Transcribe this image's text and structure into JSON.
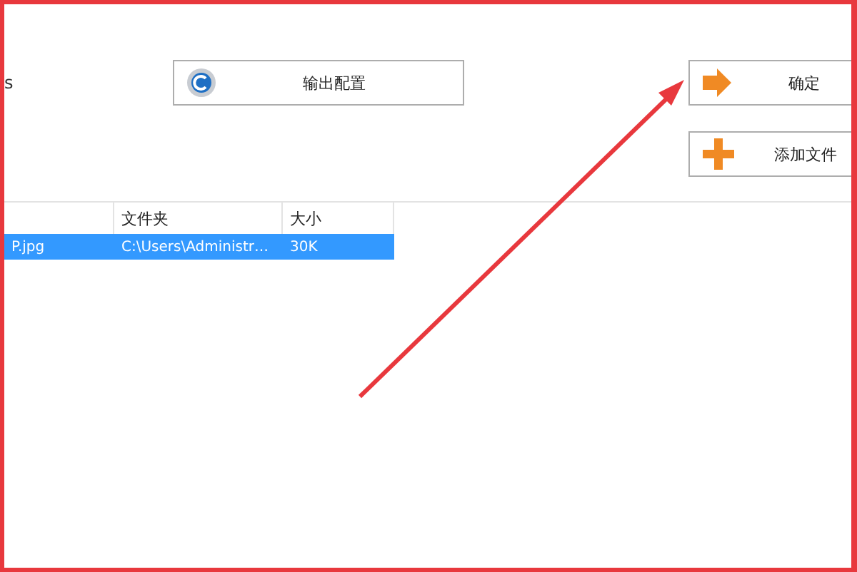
{
  "left_label": "s",
  "buttons": [
    {
      "label": "输出配置",
      "kind": "gear"
    },
    {
      "label": "确定",
      "kind": "arrow"
    },
    {
      "label": "添加文件",
      "kind": "plus"
    }
  ],
  "table": {
    "columns": [
      "",
      "文件夹",
      "大小"
    ],
    "rows": [
      {
        "cells": [
          "P.jpg",
          "C:\\Users\\Administr…",
          "30K"
        ],
        "selected": true
      }
    ]
  }
}
